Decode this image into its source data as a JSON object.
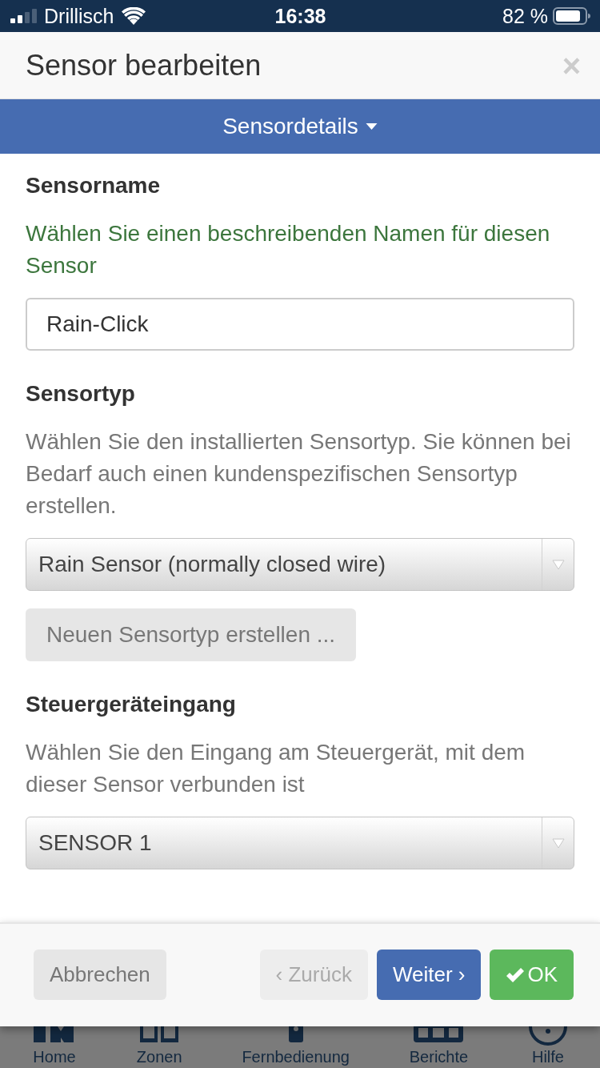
{
  "status_bar": {
    "carrier": "Drillisch",
    "time": "16:38",
    "battery": "82 %"
  },
  "dialog": {
    "title": "Sensor bearbeiten",
    "close": "×"
  },
  "section_menu": {
    "label": "Sensordetails"
  },
  "fields": [
    {
      "kind": "text",
      "label": "Sensorname",
      "help": {
        "kind": "success",
        "text": "Wählen Sie einen beschreibenden Namen für diesen Sensor"
      },
      "value": "Rain-Click"
    },
    {
      "kind": "select",
      "label": "Sensortyp",
      "help": {
        "kind": "muted",
        "text": "Wählen Sie den installierten Sensortyp. Sie können bei Bedarf auch einen kundenspezifischen Sensortyp erstellen."
      },
      "value": "Rain Sensor (normally closed wire)",
      "action": "Neuen Sensortyp erstellen ..."
    },
    {
      "kind": "select",
      "label": "Steuergeräteingang",
      "help": {
        "kind": "muted",
        "text": "Wählen Sie den Eingang am Steuergerät, mit dem dieser Sensor verbunden ist"
      },
      "value": "SENSOR 1"
    }
  ],
  "footer_buttons": [
    {
      "label": "Abbrechen",
      "kind": "default",
      "disabled": false
    },
    {
      "label": "‹ Zurück",
      "kind": "default",
      "disabled": true
    },
    {
      "label": "Weiter ›",
      "kind": "primary",
      "disabled": false
    },
    {
      "label": "OK",
      "kind": "success",
      "disabled": false
    }
  ],
  "bottom_nav": [
    {
      "label": "Home"
    },
    {
      "label": "Zonen"
    },
    {
      "label": "Fernbedienung"
    },
    {
      "label": "Berichte"
    },
    {
      "label": "Hilfe"
    }
  ]
}
